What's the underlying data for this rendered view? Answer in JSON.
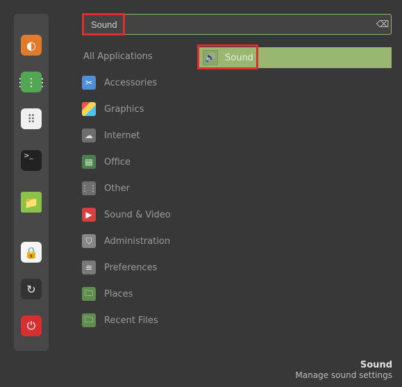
{
  "search": {
    "value": "Sound"
  },
  "launcher": [
    {
      "name": "firefox",
      "glyph": "◐"
    },
    {
      "name": "apps",
      "glyph": "⋮⋮⋮"
    },
    {
      "name": "settings",
      "glyph": "⠿"
    },
    {
      "name": "terminal",
      "glyph": ">_"
    },
    {
      "name": "files",
      "glyph": "📁"
    },
    {
      "name": "lock",
      "glyph": "🔒"
    },
    {
      "name": "refresh",
      "glyph": "↻"
    },
    {
      "name": "power",
      "glyph": "⏻"
    }
  ],
  "categories": {
    "all": "All Applications",
    "items": [
      {
        "label": "Accessories",
        "icon": "✂"
      },
      {
        "label": "Graphics",
        "icon": ""
      },
      {
        "label": "Internet",
        "icon": "☁"
      },
      {
        "label": "Office",
        "icon": "▤"
      },
      {
        "label": "Other",
        "icon": "⋮⋮"
      },
      {
        "label": "Sound & Video",
        "icon": "▶"
      },
      {
        "label": "Administration",
        "icon": "⛉"
      },
      {
        "label": "Preferences",
        "icon": "≡"
      },
      {
        "label": "Places",
        "icon": "🗀"
      },
      {
        "label": "Recent Files",
        "icon": "🗀"
      }
    ]
  },
  "result": {
    "label": "Sound",
    "icon": "🔊"
  },
  "footer": {
    "title": "Sound",
    "desc": "Manage sound settings"
  }
}
